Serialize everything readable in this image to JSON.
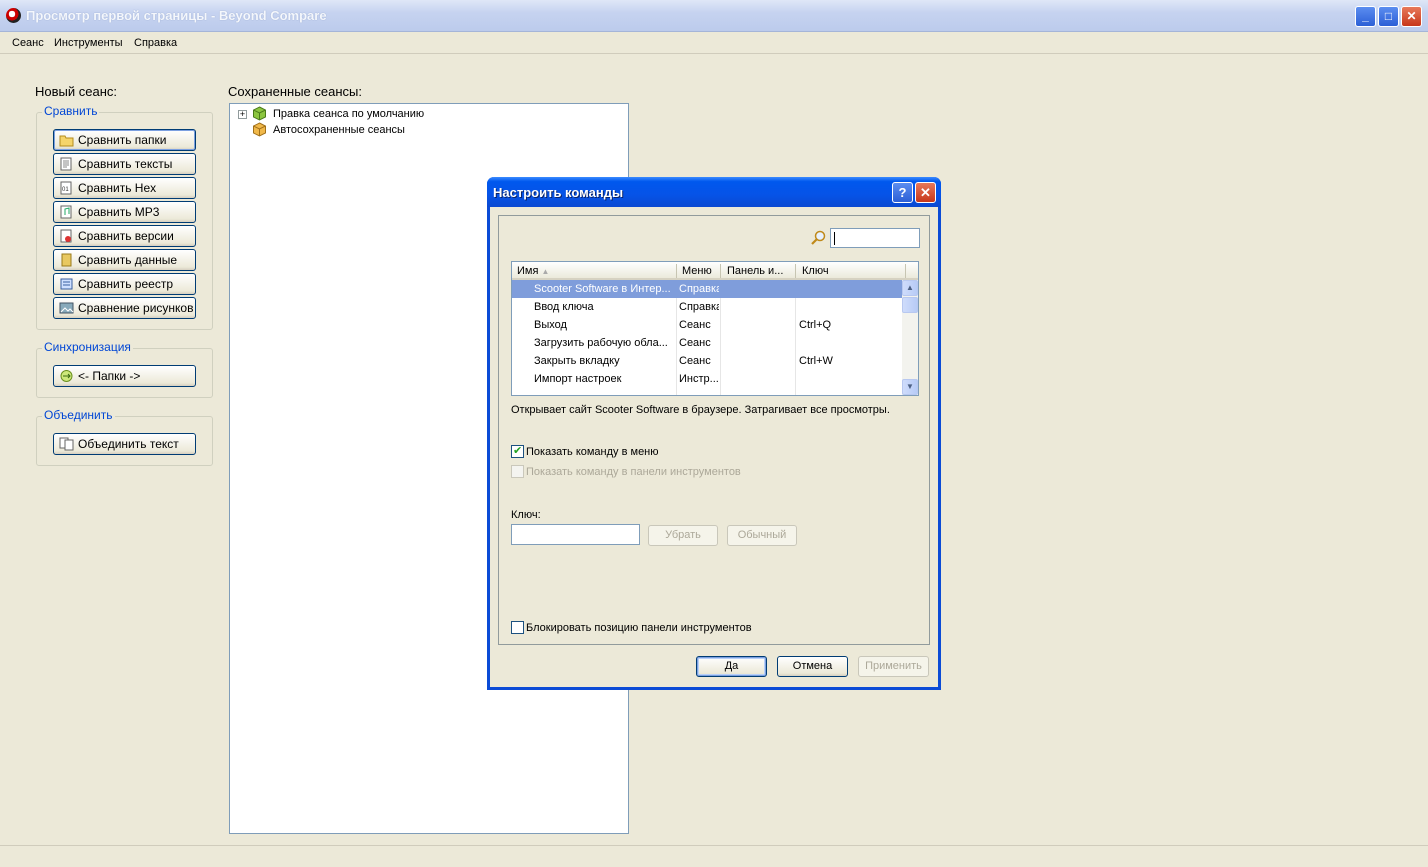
{
  "window": {
    "title": "Просмотр первой страницы - Beyond Compare"
  },
  "menu": [
    "Сеанс",
    "Инструменты",
    "Справка"
  ],
  "new_session": {
    "label": "Новый сеанс:",
    "compare_group": {
      "title": "Сравнить",
      "buttons": [
        "Сравнить папки",
        "Сравнить тексты",
        "Сравнить Hex",
        "Сравнить MP3",
        "Сравнить версии",
        "Сравнить данные",
        "Сравнить реестр",
        "Сравнение рисунков"
      ]
    },
    "sync_group": {
      "title": "Синхронизация",
      "buttons": [
        "<- Папки ->"
      ]
    },
    "merge_group": {
      "title": "Объединить",
      "buttons": [
        "Объединить текст"
      ]
    }
  },
  "saved_sessions": {
    "label": "Сохраненные сеансы:",
    "items": [
      "Правка сеанса по умолчанию",
      "Автосохраненные сеансы"
    ]
  },
  "dialog": {
    "title": "Настроить команды",
    "help": "?",
    "close": "✕",
    "search": {
      "value": ""
    },
    "columns": [
      "Имя",
      "Меню",
      "Панель и...",
      "Ключ"
    ],
    "rows": [
      [
        "Scooter Software в Интер...",
        "Справка",
        "",
        ""
      ],
      [
        "Ввод ключа",
        "Справка",
        "",
        ""
      ],
      [
        "Выход",
        "Сеанс",
        "",
        "Ctrl+Q"
      ],
      [
        "Загрузить рабочую обла...",
        "Сеанс",
        "",
        ""
      ],
      [
        "Закрыть вкладку",
        "Сеанс",
        "",
        "Ctrl+W"
      ],
      [
        "Импорт настроек",
        "Инстр...",
        "",
        ""
      ]
    ],
    "selected_row": 0,
    "description": "Открывает сайт Scooter Software в браузере.  Затрагивает все просмотры.",
    "show_in_menu": {
      "label": "Показать команду в меню",
      "checked": true
    },
    "show_in_toolbar": {
      "label": "Показать команду в панели инструментов",
      "checked": false,
      "enabled": false
    },
    "key_label": "Ключ:",
    "key_value": "",
    "remove_button": "Убрать",
    "default_button": "Обычный",
    "lock_toolbar": {
      "label": "Блокировать позицию панели инструментов",
      "checked": false
    },
    "ok_button": "Да",
    "cancel_button": "Отмена",
    "apply_button": "Применить"
  }
}
